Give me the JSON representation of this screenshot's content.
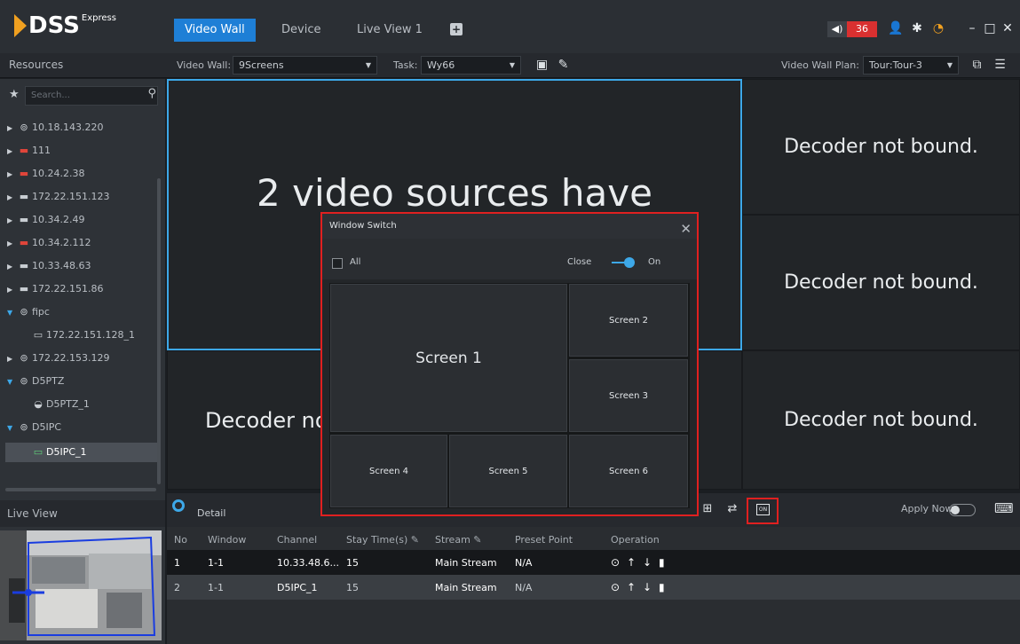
{
  "app": {
    "logo_text": "DSS",
    "logo_sup": "Express",
    "tabs": [
      {
        "label": "Video Wall",
        "active": true
      },
      {
        "label": "Device",
        "active": false
      },
      {
        "label": "Live View 1",
        "active": false
      }
    ],
    "add_tab_icon": "plus-icon",
    "alarm_count": "36",
    "accent_color": "#1e7fd6",
    "highlight_color": "#e02020"
  },
  "toolbar": {
    "resources_title": "Resources",
    "video_wall_label": "Video Wall:",
    "video_wall_value": "9Screens",
    "task_label": "Task:",
    "task_value": "Wy66",
    "plan_label": "Video Wall Plan:",
    "plan_value": "Tour:Tour-3"
  },
  "sidebar": {
    "search_placeholder": "Search...",
    "tree": [
      {
        "label": "10.18.143.220",
        "icon": "encoder-icon"
      },
      {
        "label": "111",
        "icon": "nvr-icon"
      },
      {
        "label": "10.24.2.38",
        "icon": "nvr-icon"
      },
      {
        "label": "172.22.151.123",
        "icon": "nvr-icon"
      },
      {
        "label": "10.34.2.49",
        "icon": "nvr-icon"
      },
      {
        "label": "10.34.2.112",
        "icon": "nvr-icon"
      },
      {
        "label": "10.33.48.63",
        "icon": "nvr-icon"
      },
      {
        "label": "172.22.151.86",
        "icon": "nvr-icon"
      },
      {
        "label": "fipc",
        "icon": "encoder-icon"
      },
      {
        "label": "172.22.151.128_1",
        "icon": "camera-icon"
      },
      {
        "label": "172.22.153.129",
        "icon": "encoder-icon"
      },
      {
        "label": "D5PTZ",
        "icon": "encoder-icon"
      },
      {
        "label": "D5PTZ_1",
        "icon": "ptz-icon"
      },
      {
        "label": "D5IPC",
        "icon": "encoder-icon"
      },
      {
        "label": "D5IPC_1",
        "icon": "camera-icon"
      }
    ],
    "live_view_title": "Live View"
  },
  "wall": {
    "big_message": "2 video sources have",
    "decoder_msg": "Decoder not bound.",
    "decoder_msg_cut": "Decoder no"
  },
  "modal": {
    "title": "Window Switch",
    "all_label": "All",
    "close_label": "Close",
    "on_label": "On",
    "screens": [
      "Screen 1",
      "Screen 2",
      "Screen 3",
      "Screen 4",
      "Screen 5",
      "Screen 6"
    ]
  },
  "bottom": {
    "detail_label": "Detail",
    "apply_now_label": "Apply Now",
    "on_button_text": "ON",
    "columns": [
      "No",
      "Window",
      "Channel",
      "Stay Time(s)",
      "Stream",
      "Preset Point",
      "Operation"
    ],
    "rows": [
      {
        "no": "1",
        "window": "1-1",
        "channel": "10.33.48.6...",
        "stay": "15",
        "stream": "Main Stream",
        "preset": "N/A"
      },
      {
        "no": "2",
        "window": "1-1",
        "channel": "D5IPC_1",
        "stay": "15",
        "stream": "Main Stream",
        "preset": "N/A"
      }
    ]
  }
}
